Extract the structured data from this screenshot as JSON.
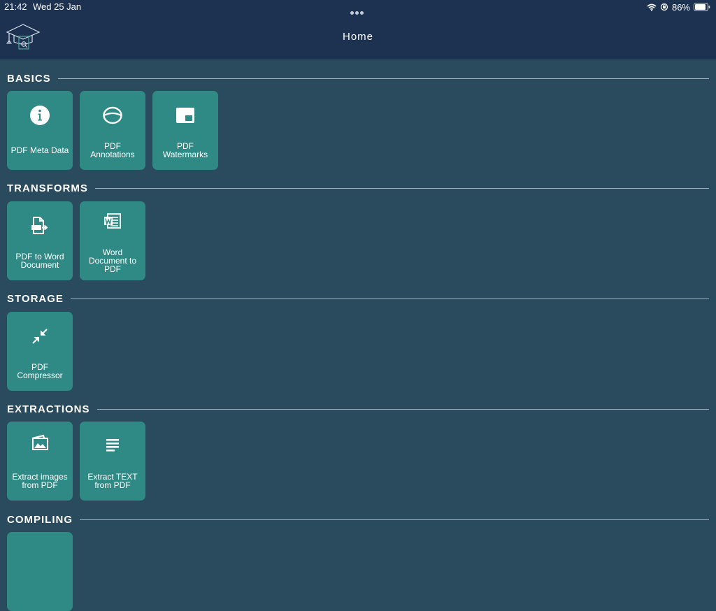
{
  "status_bar": {
    "time": "21:42",
    "date": "Wed 25 Jan",
    "battery": "86%"
  },
  "header": {
    "title": "Home"
  },
  "colors": {
    "background": "#2a4a5e",
    "header": "#1c3250",
    "tile": "#2f8a85"
  },
  "sections": {
    "basics": {
      "title": "BASICS",
      "tiles": [
        {
          "label": "PDF Meta Data",
          "icon": "info-icon"
        },
        {
          "label": "PDF Annotations",
          "icon": "annotation-icon"
        },
        {
          "label": "PDF Watermarks",
          "icon": "watermark-icon"
        }
      ]
    },
    "transforms": {
      "title": "TRANSFORMS",
      "tiles": [
        {
          "label": "PDF to Word Document",
          "icon": "pdf-file-arrow-icon"
        },
        {
          "label": "Word Document to PDF",
          "icon": "word-document-icon"
        }
      ]
    },
    "storage": {
      "title": "STORAGE",
      "tiles": [
        {
          "label": "PDF Compressor",
          "icon": "compress-arrows-icon"
        }
      ]
    },
    "extractions": {
      "title": "EXTRACTIONS",
      "tiles": [
        {
          "label": "Extract images from PDF",
          "icon": "images-icon"
        },
        {
          "label": "Extract TEXT from PDF",
          "icon": "text-lines-icon"
        }
      ]
    },
    "compiling": {
      "title": "COMPILING"
    }
  }
}
